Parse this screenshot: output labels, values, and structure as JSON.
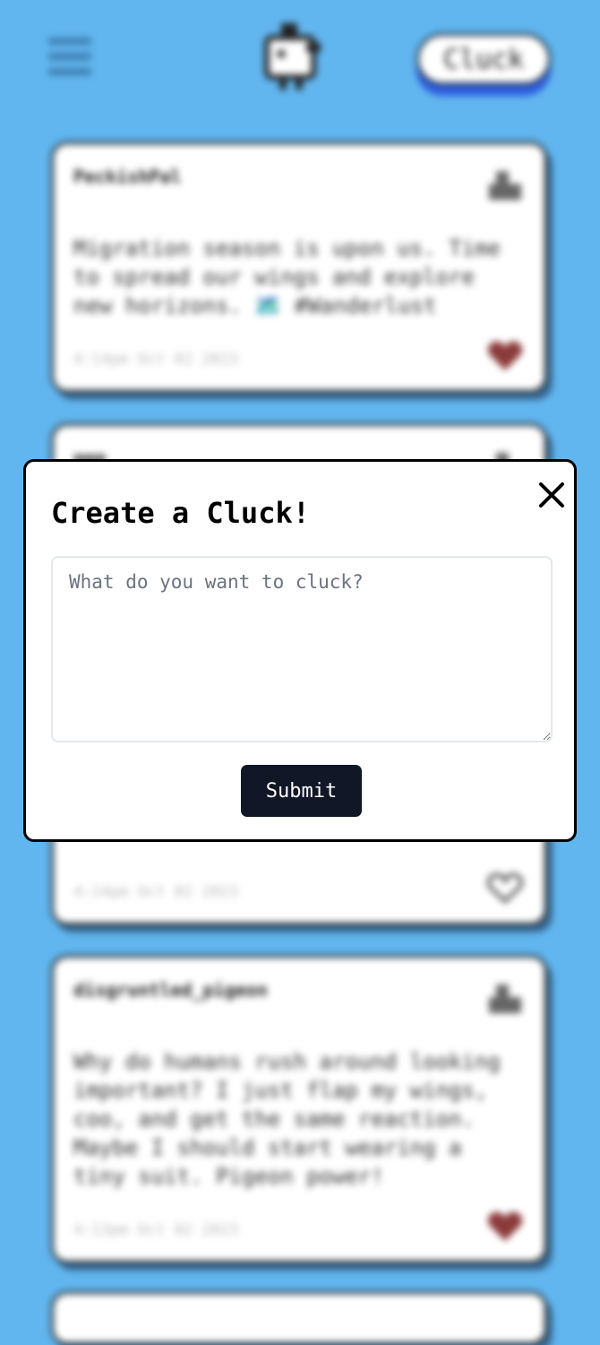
{
  "header": {
    "cluck_button_label": "Cluck"
  },
  "feed": {
    "posts": [
      {
        "username": "PeckishPal",
        "text": "Migration season is upon us. Time to spread our wings and explore new horizons. 🗺️ #Wanderlust",
        "timestamp": "4:14pm Oct 02 2023",
        "liked": true
      },
      {
        "username": "mmm",
        "text": "",
        "timestamp": "4:14pm Oct 02 2023",
        "liked": false
      },
      {
        "username": "disgruntled_pigeon",
        "text": "Why do humans rush around looking important? I just flap my wings, coo, and get the same reaction. Maybe I should start wearing a tiny suit. Pigeon power!",
        "timestamp": "4:13pm Oct 02 2023",
        "liked": true
      }
    ]
  },
  "modal": {
    "title": "Create a Cluck!",
    "input_placeholder": "What do you want to cluck?",
    "input_value": "",
    "submit_label": "Submit"
  },
  "icons": {
    "menu": "hamburger-menu-icon",
    "logo": "chicken-logo-icon",
    "avatar": "avatar-icon",
    "like": "heart-icon",
    "close": "close-icon"
  },
  "colors": {
    "background": "#62b6ef",
    "button_shadow": "#2f5fe0",
    "heart_liked": "#8b3a3a",
    "submit_bg": "#121727"
  }
}
